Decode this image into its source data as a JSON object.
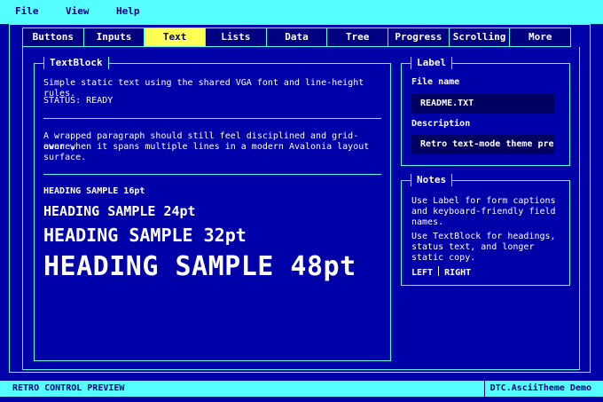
{
  "menu": {
    "items": [
      "File",
      "View",
      "Help"
    ]
  },
  "tabs": [
    "Buttons",
    "Inputs",
    "Text",
    "Lists",
    "Data",
    "Tree",
    "Progress",
    "Scrolling",
    "More"
  ],
  "active_tab": "Text",
  "textblock": {
    "legend": "TextBlock",
    "line1": "Simple static text using the shared VGA font and line-height rules.",
    "status": "STATUS: READY",
    "wrapped": [
      "A wrapped paragraph should still feel disciplined and grid-aware,",
      "even when it spans multiple lines in a modern Avalonia layout",
      "surface."
    ],
    "headings": {
      "h16": "HEADING SAMPLE 16pt",
      "h24": "HEADING SAMPLE 24pt",
      "h32": "HEADING SAMPLE 32pt",
      "h48": "HEADING SAMPLE 48pt"
    }
  },
  "label_panel": {
    "legend": "Label",
    "file_name_label": "File name",
    "file_name_value": "README.TXT",
    "description_label": "Description",
    "description_value": "Retro text-mode theme preview"
  },
  "notes": {
    "legend": "Notes",
    "para1": [
      "Use Label for form captions",
      "and keyboard-friendly field",
      "names."
    ],
    "para2": [
      "Use TextBlock for headings,",
      "status text, and longer",
      "static copy."
    ],
    "left": "LEFT",
    "right": "RIGHT"
  },
  "status": {
    "left": "RETRO CONTROL PREVIEW",
    "right": "DTC.AsciiTheme Demo"
  },
  "colors": {
    "background": "#0000a8",
    "accent": "#55ffff",
    "active_tab": "#ffff55"
  }
}
